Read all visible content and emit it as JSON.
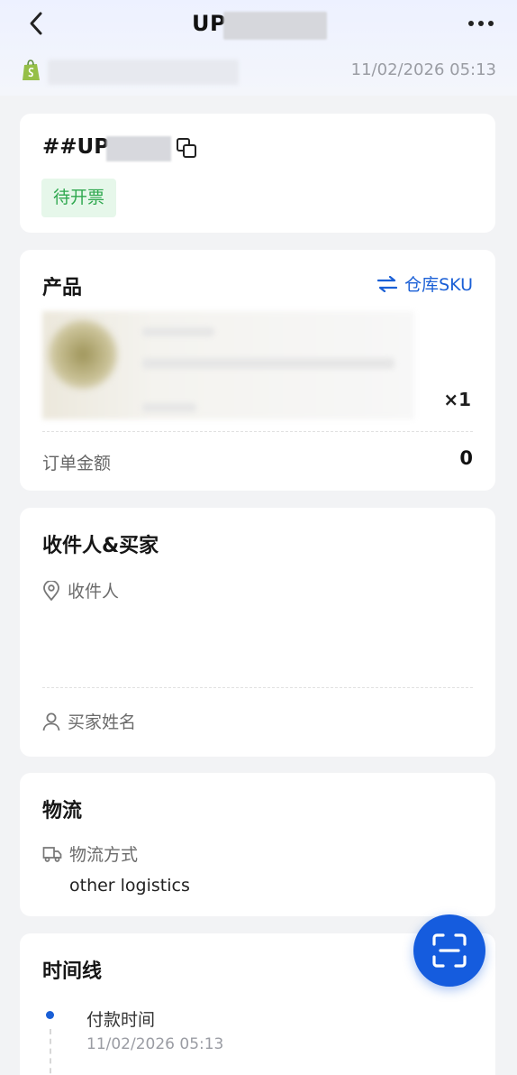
{
  "header": {
    "title": "UP",
    "store_time": "11/02/2026 05:13"
  },
  "order": {
    "number": "##UP",
    "status": "待开票"
  },
  "product": {
    "section_title": "产品",
    "sku_link": "仓库SKU",
    "quantity": "×1",
    "amount_label": "订单金额",
    "amount_value": "0"
  },
  "recipient": {
    "section_title": "收件人&买家",
    "recipient_label": "收件人",
    "buyer_label": "买家姓名"
  },
  "logistics": {
    "section_title": "物流",
    "method_label": "物流方式",
    "method_value": "other logistics"
  },
  "timeline": {
    "section_title": "时间线",
    "events": [
      {
        "label": "付款时间",
        "time": "11/02/2026 05:13"
      }
    ]
  },
  "colors": {
    "accent": "#155cde",
    "status_green": "#2fa84f",
    "status_bg": "#e6f7ea",
    "store_icon": "#95bf47"
  },
  "icons": {
    "back": "chevron-left-icon",
    "more": "more-horizontal-icon",
    "store": "shopify-bag-icon",
    "copy": "copy-icon",
    "sku": "swap-arrows-icon",
    "location": "map-pin-icon",
    "buyer": "user-icon",
    "truck": "truck-icon",
    "scan": "scan-icon"
  }
}
